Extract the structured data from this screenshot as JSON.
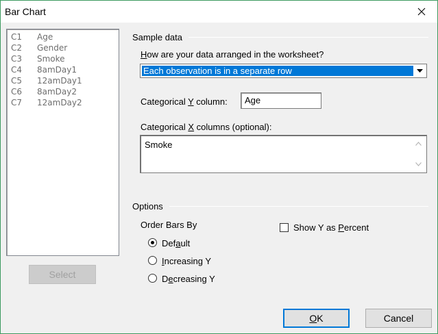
{
  "window": {
    "title": "Bar Chart"
  },
  "columns": [
    {
      "id": "C1",
      "name": "Age"
    },
    {
      "id": "C2",
      "name": "Gender"
    },
    {
      "id": "C3",
      "name": "Smoke"
    },
    {
      "id": "C4",
      "name": "8amDay1"
    },
    {
      "id": "C5",
      "name": "12amDay1"
    },
    {
      "id": "C6",
      "name": "8amDay2"
    },
    {
      "id": "C7",
      "name": "12amDay2"
    }
  ],
  "select_button": {
    "label": "Select"
  },
  "sample_data": {
    "group_label": "Sample data",
    "arrangement_label_pre": "",
    "arrangement_label_key": "H",
    "arrangement_label_post": "ow are your data arranged in the worksheet?",
    "arrangement_value": "Each observation is in a separate row",
    "y_label_pre": "Categorical ",
    "y_label_key": "Y",
    "y_label_post": " column:",
    "y_value": "Age",
    "x_label_pre": "Categorical ",
    "x_label_key": "X",
    "x_label_post": " columns (optional):",
    "x_value": "Smoke"
  },
  "options": {
    "group_label": "Options",
    "order_label": "Order Bars By",
    "radios": [
      {
        "pre": "Def",
        "key": "a",
        "post": "ult",
        "checked": true
      },
      {
        "pre": "",
        "key": "I",
        "post": "ncreasing Y",
        "checked": false
      },
      {
        "pre": "D",
        "key": "e",
        "post": "creasing Y",
        "checked": false
      }
    ],
    "show_y_pre": "Show Y as ",
    "show_y_key": "P",
    "show_y_post": "ercent",
    "show_y_checked": false
  },
  "buttons": {
    "ok_pre": "",
    "ok_key": "O",
    "ok_post": "K",
    "cancel": "Cancel"
  }
}
